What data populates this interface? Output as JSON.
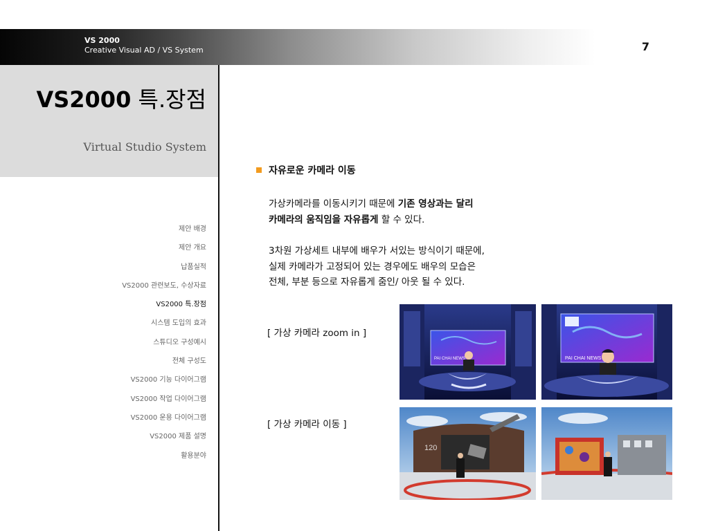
{
  "header": {
    "brand_title": "VS 2000",
    "brand_subtitle": "Creative Visual AD / VS System",
    "page_number": "7"
  },
  "title_panel": {
    "title_strong": "VS2000",
    "title_rest": " 특.장점",
    "subtitle": "Virtual Studio System"
  },
  "nav": {
    "items": [
      "제안 배경",
      "제안 개요",
      "납품실적",
      "VS2000 관련보도, 수상자료",
      "VS2000 특.장점",
      "시스템 도입의 효과",
      "스튜디오 구성예시",
      "전체 구성도",
      "VS2000 기능 다이어그램",
      "VS2000 작업 다이어그램",
      "VS2000 운용 다이어그램",
      "VS2000 제품 설명",
      "활용분야"
    ],
    "active_index": 4
  },
  "content": {
    "heading": "자유로운 카메라 이동",
    "p1_line1_plain": "가상카메라를 이동시키기 때문에 ",
    "p1_line1_bold": "기존 영상과는 달리",
    "p1_line2_bold": "카메라의 움직임을 자유롭게",
    "p1_line2_plain": " 할 수 있다.",
    "p2_line1": "3차원 가상세트 내부에 배우가 서있는 방식이기 때문에,",
    "p2_line2": "실제 카메라가 고정되어 있는 경우에도 배우의 모습은",
    "p2_line3": "전체, 부분 등으로 자유롭게 줌인/ 아웃 될 수 있다.",
    "caption_zoom": "[ 가상 카메라 zoom in ]",
    "caption_move": "[ 가상 카메라 이동 ]",
    "screen_label": "PAI CHAI NEWS",
    "set_number": "120"
  },
  "colors": {
    "bullet": "#f29b1f",
    "panel": "#dcdcdc"
  }
}
